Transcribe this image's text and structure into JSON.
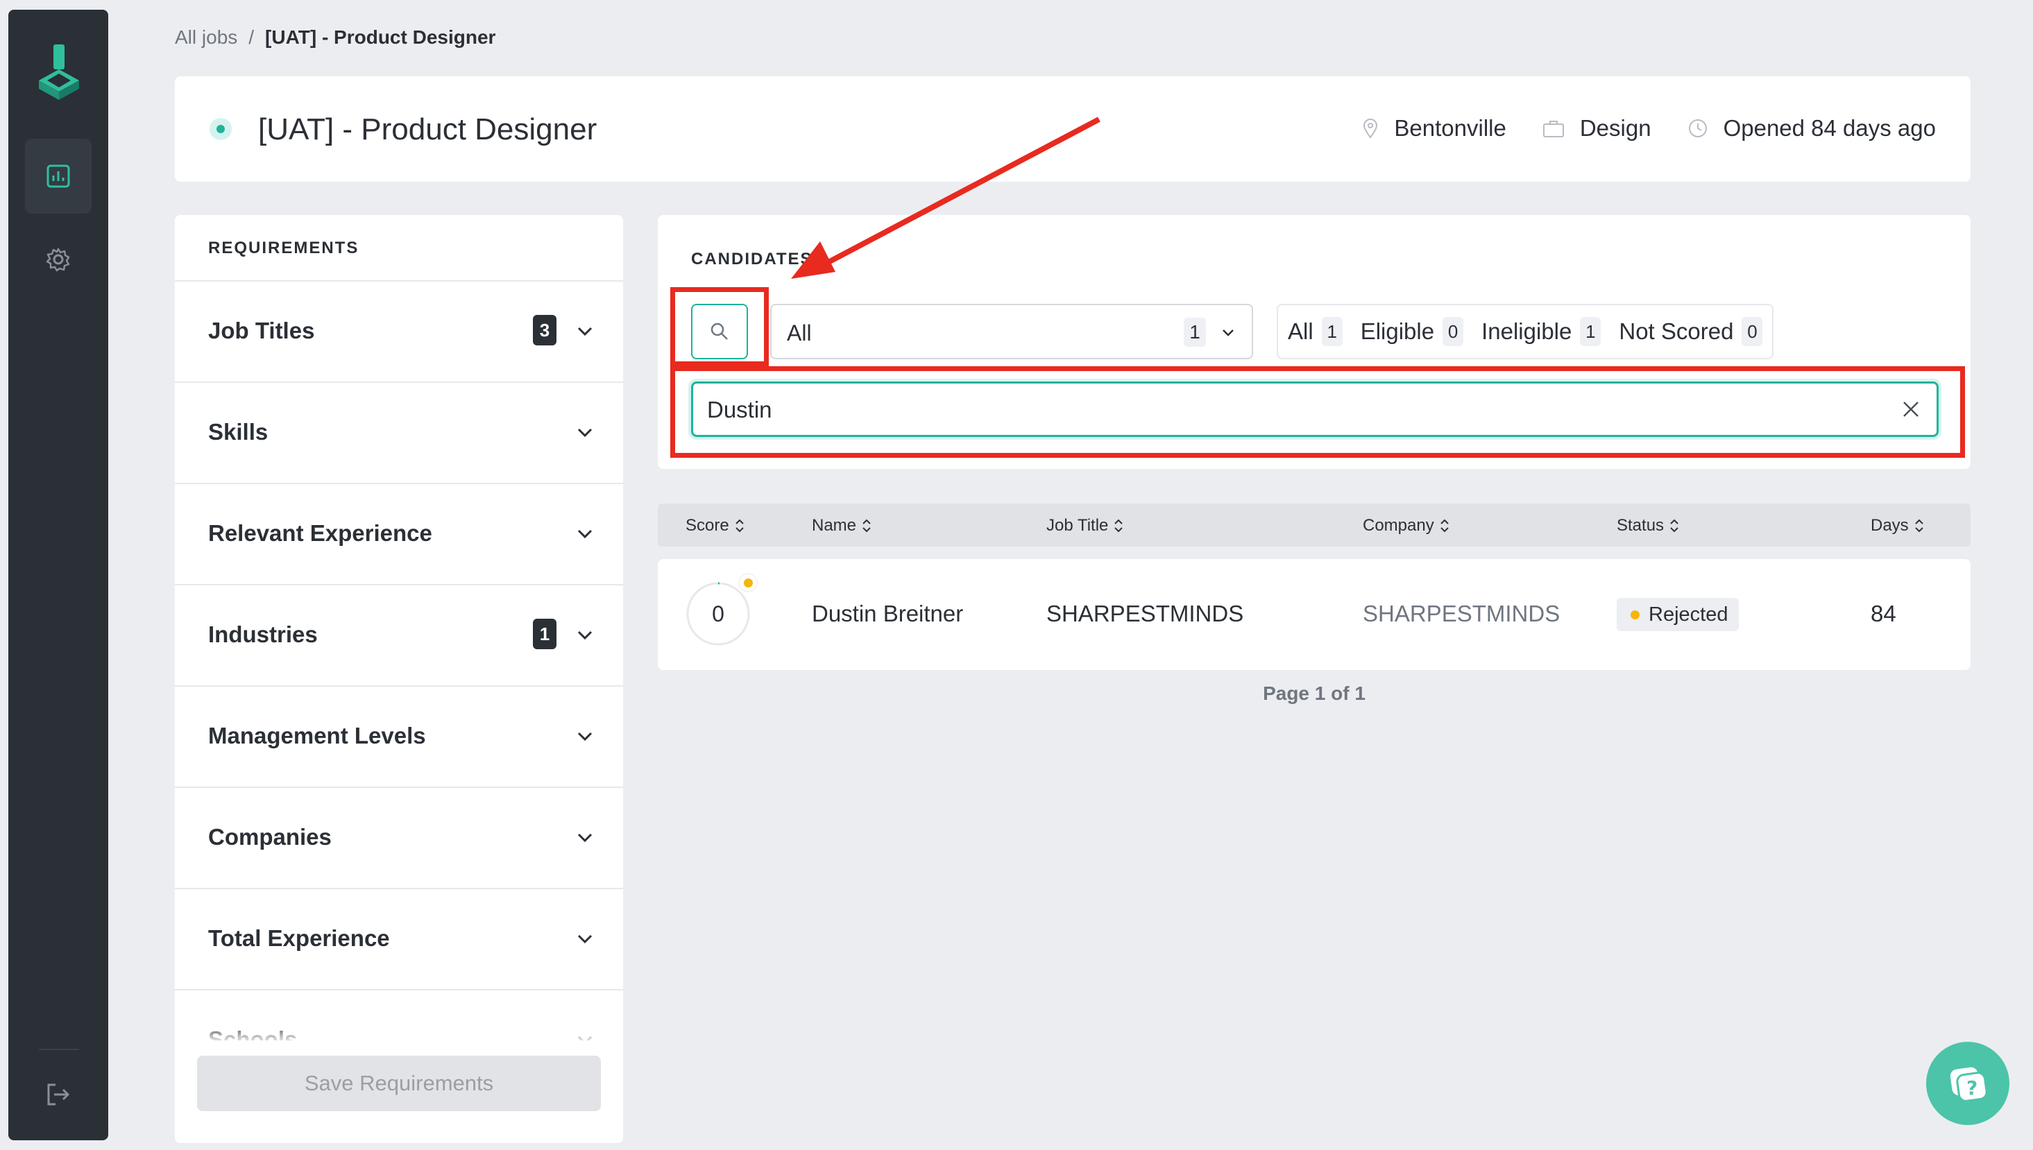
{
  "breadcrumb": {
    "root": "All jobs",
    "separator": "/",
    "current": "[UAT] - Product Designer"
  },
  "job": {
    "title": "[UAT] - Product Designer",
    "location": "Bentonville",
    "department": "Design",
    "opened": "Opened 84 days ago"
  },
  "requirements": {
    "heading": "REQUIREMENTS",
    "items": [
      {
        "label": "Job Titles",
        "count": "3"
      },
      {
        "label": "Skills",
        "count": ""
      },
      {
        "label": "Relevant Experience",
        "count": ""
      },
      {
        "label": "Industries",
        "count": "1"
      },
      {
        "label": "Management Levels",
        "count": ""
      },
      {
        "label": "Companies",
        "count": ""
      },
      {
        "label": "Total Experience",
        "count": ""
      },
      {
        "label": "Schools",
        "count": ""
      }
    ],
    "save_label": "Save Requirements"
  },
  "candidates": {
    "heading": "CANDIDATES",
    "select": {
      "value": "All",
      "count": "1"
    },
    "filters": [
      {
        "label": "All",
        "count": "1"
      },
      {
        "label": "Eligible",
        "count": "0"
      },
      {
        "label": "Ineligible",
        "count": "1"
      },
      {
        "label": "Not Scored",
        "count": "0"
      }
    ],
    "search_value": "Dustin"
  },
  "table": {
    "columns": [
      "Score",
      "Name",
      "Job Title",
      "Company",
      "Status",
      "Days"
    ],
    "rows": [
      {
        "score": "0",
        "name": "Dustin Breitner",
        "job_title": "SHARPESTMINDS",
        "company": "SHARPESTMINDS",
        "status": "Rejected",
        "days": "84"
      }
    ],
    "pager": "Page 1 of 1"
  },
  "colors": {
    "accent": "#1fb39b",
    "sidebar": "#2a3036",
    "annotation": "#e82a1f",
    "status_warning": "#f5b50a",
    "help": "#4cc4a9"
  },
  "icons": [
    "logo-icon",
    "analytics-icon",
    "settings-icon",
    "logout-icon",
    "location-icon",
    "briefcase-icon",
    "clock-icon",
    "chevron-down-icon",
    "search-icon",
    "close-icon",
    "sort-icon",
    "help-icon"
  ]
}
